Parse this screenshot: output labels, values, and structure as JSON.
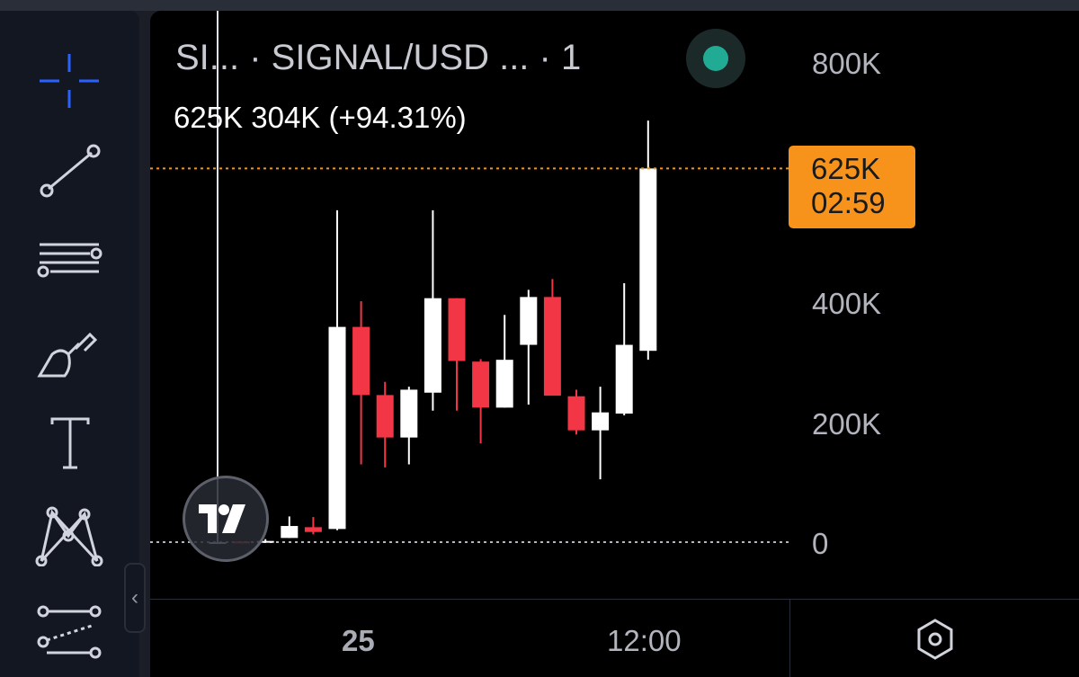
{
  "sidebar": {
    "tools": [
      {
        "name": "crosshair-icon",
        "label": "Crosshair"
      },
      {
        "name": "trend-line-icon",
        "label": "Trend line"
      },
      {
        "name": "fib-levels-icon",
        "label": "Fib retracement"
      },
      {
        "name": "brush-icon",
        "label": "Brush"
      },
      {
        "name": "text-icon",
        "label": "Text"
      },
      {
        "name": "pattern-icon",
        "label": "Patterns"
      },
      {
        "name": "prediction-icon",
        "label": "Prediction"
      }
    ],
    "collapse_glyph": "‹"
  },
  "legend": {
    "title": "SI...  · SIGNAL/USD ...  · 1",
    "values": "625K  304K (+94.31%)",
    "status_color": "#22ab94"
  },
  "price_axis": {
    "labels": [
      "800K",
      "400K",
      "200K",
      "0"
    ]
  },
  "last_price": {
    "value": "625K",
    "countdown": "02:59",
    "color": "#f7931a"
  },
  "time_axis": {
    "labels": [
      {
        "text": "25",
        "bold": true
      },
      {
        "text": "12:00",
        "bold": false
      }
    ]
  },
  "logo": {
    "text": "TV"
  },
  "colors": {
    "up": "#ffffff",
    "down": "#f23645",
    "price_line": "#f7931a",
    "zero_line": "#b2b5be"
  },
  "chart_data": {
    "type": "candlestick",
    "y_unit": "K",
    "ylim": [
      0,
      800
    ],
    "series": [
      {
        "o": 0,
        "h": 0,
        "l": 0,
        "c": 0
      },
      {
        "o": 1,
        "h": 1,
        "l": 0,
        "c": 0
      },
      {
        "o": 0,
        "h": 5,
        "l": 0,
        "c": 2
      },
      {
        "o": 7,
        "h": 43,
        "l": 7,
        "c": 27
      },
      {
        "o": 25,
        "h": 42,
        "l": 13,
        "c": 17
      },
      {
        "o": 22,
        "h": 555,
        "l": 20,
        "c": 360
      },
      {
        "o": 360,
        "h": 403,
        "l": 130,
        "c": 246
      },
      {
        "o": 246,
        "h": 268,
        "l": 125,
        "c": 175
      },
      {
        "o": 175,
        "h": 260,
        "l": 130,
        "c": 255
      },
      {
        "o": 250,
        "h": 555,
        "l": 220,
        "c": 408
      },
      {
        "o": 408,
        "h": 408,
        "l": 220,
        "c": 303
      },
      {
        "o": 302,
        "h": 306,
        "l": 165,
        "c": 225
      },
      {
        "o": 225,
        "h": 380,
        "l": 225,
        "c": 305
      },
      {
        "o": 330,
        "h": 422,
        "l": 230,
        "c": 410
      },
      {
        "o": 410,
        "h": 440,
        "l": 250,
        "c": 245
      },
      {
        "o": 244,
        "h": 255,
        "l": 180,
        "c": 187
      },
      {
        "o": 187,
        "h": 260,
        "l": 105,
        "c": 217
      },
      {
        "o": 215,
        "h": 433,
        "l": 212,
        "c": 330
      },
      {
        "o": 320,
        "h": 705,
        "l": 305,
        "c": 625
      }
    ]
  }
}
